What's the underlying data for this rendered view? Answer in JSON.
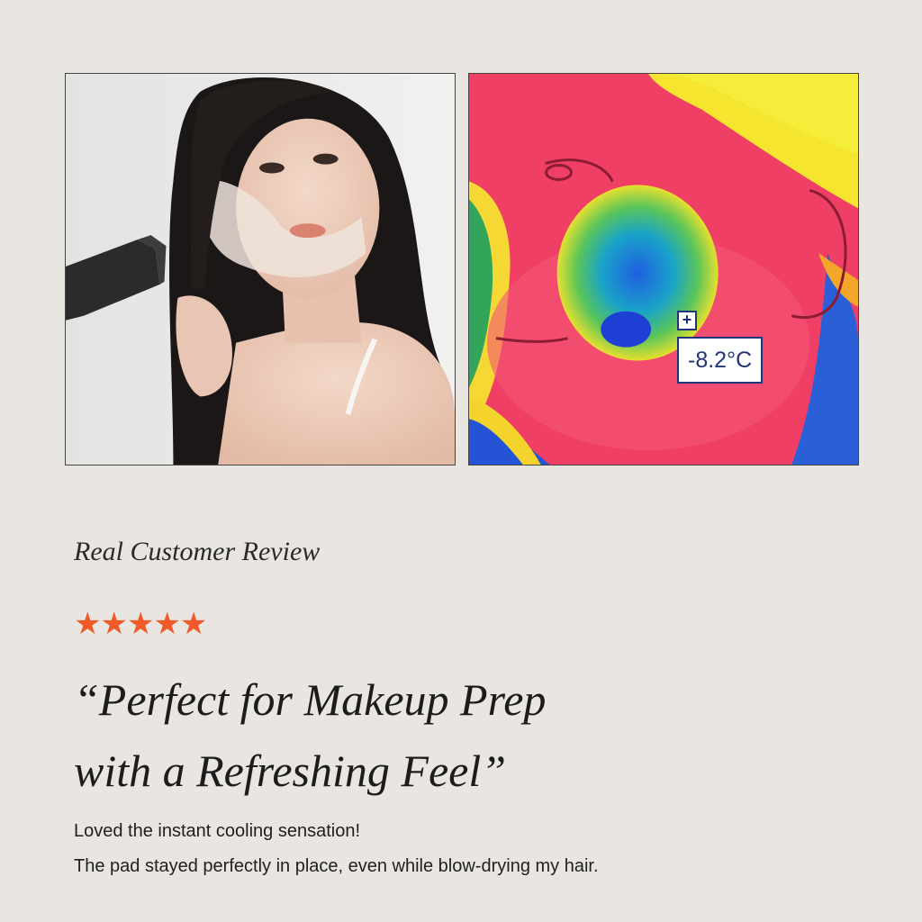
{
  "images": {
    "left_photo_icon": "woman-with-cooling-pad-photo",
    "right_photo_icon": "thermal-camera-image"
  },
  "thermal": {
    "marker_symbol": "+",
    "temperature": "-8.2°C"
  },
  "review": {
    "heading": "Real Customer Review",
    "stars": "★★★★★",
    "rating": 5,
    "star_color": "#f05a2a",
    "quote_line1": "“Perfect for Makeup Prep",
    "quote_line2": "with a Refreshing Feel”",
    "body_line1": "Loved the instant cooling sensation!",
    "body_line2": "The pad stayed perfectly in place, even while blow-drying my hair."
  }
}
